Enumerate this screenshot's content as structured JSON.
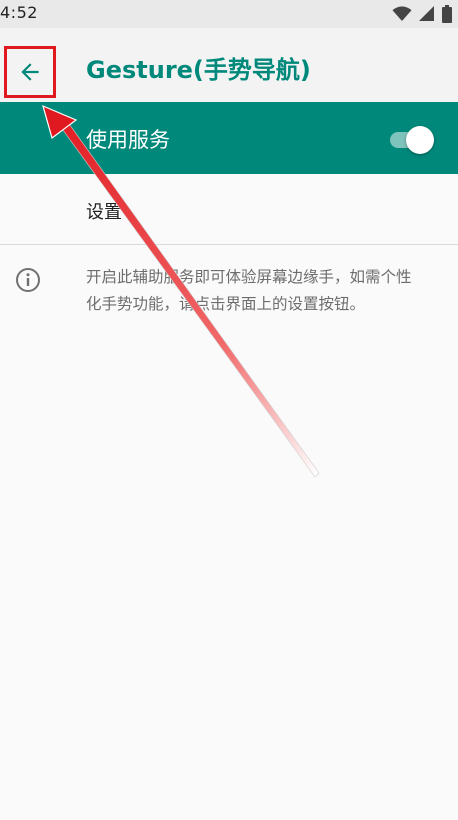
{
  "status_bar": {
    "time": "4:52",
    "icons": [
      "wifi-icon",
      "signal-icon",
      "battery-icon"
    ]
  },
  "toolbar": {
    "back_icon": "arrow-back-icon",
    "title": "Gesture(手势导航)"
  },
  "service": {
    "label": "使用服务",
    "enabled": true
  },
  "settings": {
    "label": "设置"
  },
  "info": {
    "icon": "info-icon",
    "text": "开启此辅助服务即可体验屏幕边缘手，如需个性化手势功能，请点击界面上的设置按钮。"
  },
  "colors": {
    "accent": "#00897b",
    "annotation": "#e0181f",
    "background": "#fafafa"
  }
}
